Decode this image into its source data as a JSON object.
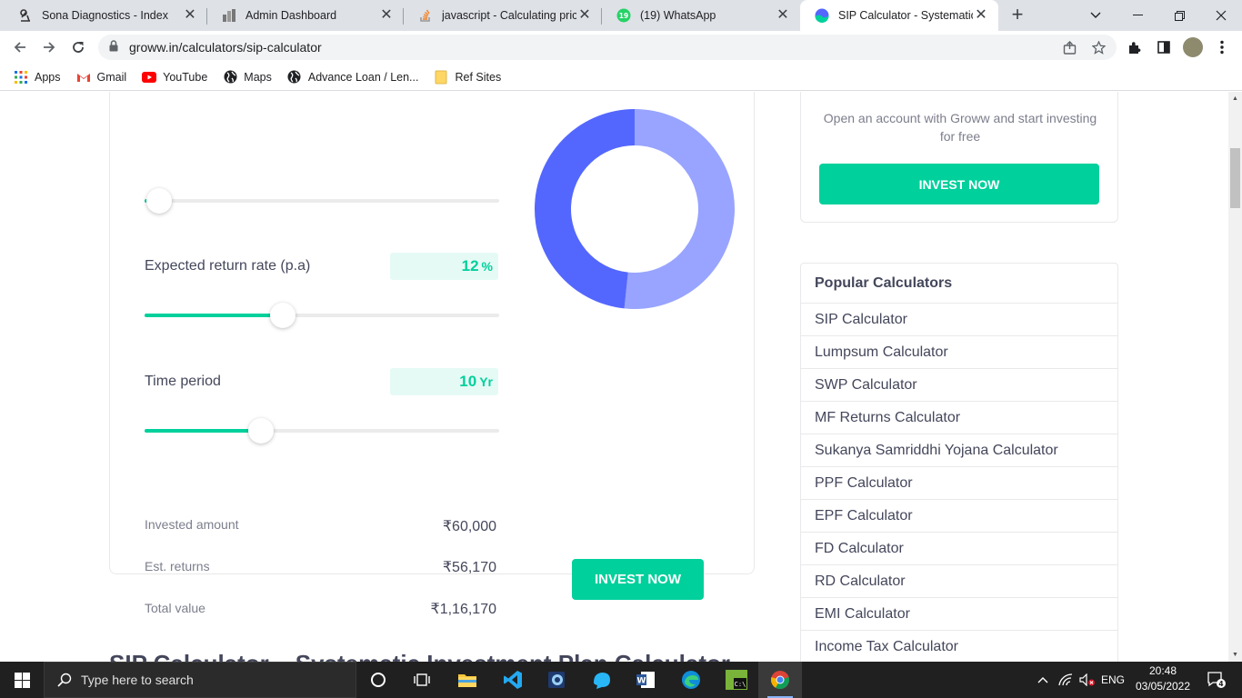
{
  "browser": {
    "tabs": [
      {
        "title": "Sona Diagnostics - Index",
        "icon": "microscope-icon"
      },
      {
        "title": "Admin Dashboard",
        "icon": "dashboard-icon"
      },
      {
        "title": "javascript - Calculating price",
        "icon": "stackoverflow-icon"
      },
      {
        "title": "(19) WhatsApp",
        "icon": "whatsapp-icon",
        "badge": "19"
      },
      {
        "title": "SIP Calculator - Systematic In",
        "icon": "groww-icon",
        "active": true
      }
    ],
    "url": "groww.in/calculators/sip-calculator",
    "bookmarks": [
      {
        "label": "Apps",
        "icon": "apps-grid-icon"
      },
      {
        "label": "Gmail",
        "icon": "gmail-icon"
      },
      {
        "label": "YouTube",
        "icon": "youtube-icon"
      },
      {
        "label": "Maps",
        "icon": "globe-icon"
      },
      {
        "label": "Advance Loan / Len...",
        "icon": "globe-icon"
      },
      {
        "label": "Ref Sites",
        "icon": "folder-icon"
      }
    ]
  },
  "calculator": {
    "monthly_slider_fraction": 0.04,
    "return_rate": {
      "label": "Expected return rate (p.a)",
      "value": "12",
      "unit": "%",
      "fraction": 0.39
    },
    "time_period": {
      "label": "Time period",
      "value": "10",
      "unit": "Yr",
      "fraction": 0.327
    },
    "results": [
      {
        "label": "Invested amount",
        "value": "₹60,000"
      },
      {
        "label": "Est. returns",
        "value": "₹56,170"
      },
      {
        "label": "Total value",
        "value": "₹1,16,170"
      }
    ],
    "invest_button": "INVEST NOW",
    "donut": {
      "invested": 60000,
      "returns": 56170,
      "invested_color": "#98a4ff",
      "returns_color": "#5367ff"
    }
  },
  "sidebar": {
    "promo_text": "Open an account with Groww and start investing for free",
    "invest_button": "INVEST NOW",
    "popular_title": "Popular Calculators",
    "popular": [
      "SIP Calculator",
      "Lumpsum Calculator",
      "SWP Calculator",
      "MF Returns Calculator",
      "Sukanya Samriddhi Yojana Calculator",
      "PPF Calculator",
      "EPF Calculator",
      "FD Calculator",
      "RD Calculator",
      "EMI Calculator",
      "Income Tax Calculator"
    ]
  },
  "section_heading": "SIP Calculator – Systematic Investment Plan Calculator",
  "taskbar": {
    "search_placeholder": "Type here to search",
    "language": "ENG",
    "time": "20:48",
    "date": "03/05/2022",
    "notifications": "4"
  },
  "colors": {
    "accent": "#00d09c",
    "text": "#44475b",
    "muted": "#7c7e8c"
  }
}
